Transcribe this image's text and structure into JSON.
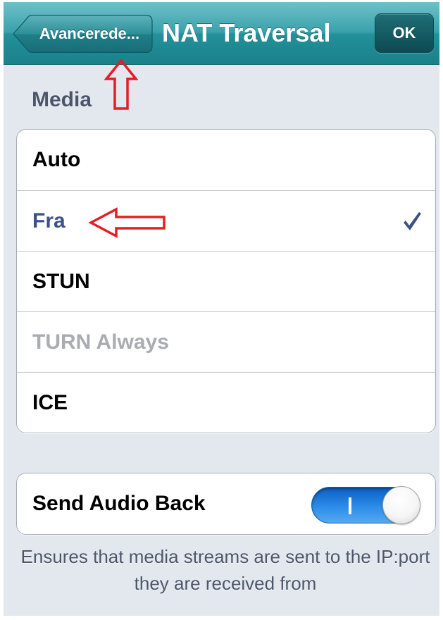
{
  "navbar": {
    "back_label": "Avancerede...",
    "title": "NAT Traversal",
    "ok_label": "OK"
  },
  "media_section": {
    "header": "Media",
    "options": [
      {
        "label": "Auto",
        "state": "normal"
      },
      {
        "label": "Fra",
        "state": "selected"
      },
      {
        "label": "STUN",
        "state": "normal"
      },
      {
        "label": "TURN Always",
        "state": "disabled"
      },
      {
        "label": "ICE",
        "state": "normal"
      }
    ],
    "checkmark_icon": "checkmark-icon"
  },
  "audio_section": {
    "label": "Send Audio Back",
    "toggle_on": true
  },
  "footer": {
    "text": "Ensures that media streams are sent to the IP:port they are received from"
  },
  "colors": {
    "navbar": "#2a98a2",
    "selected_text": "#3b5285",
    "disabled_text": "#a9acb0",
    "toggle_on": "#2c8ce8",
    "annotation": "#e41e26"
  },
  "annotations": [
    "up-arrow-icon",
    "left-arrow-icon"
  ]
}
